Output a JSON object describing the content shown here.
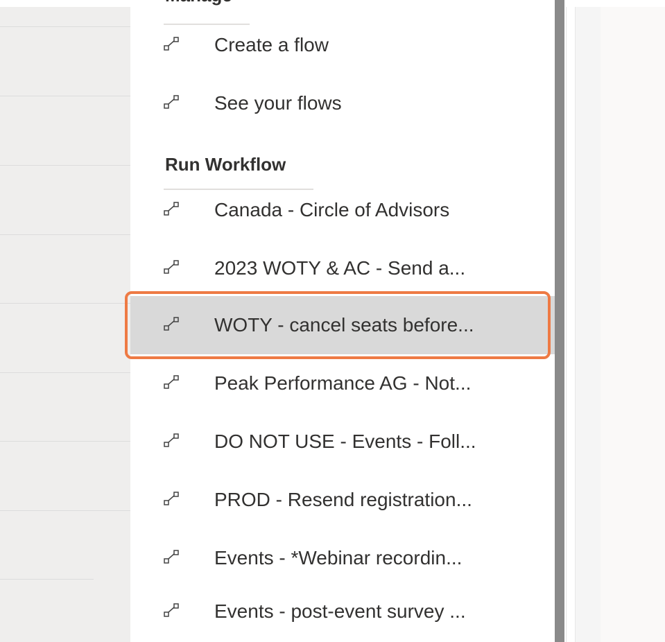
{
  "menu": {
    "sections": [
      {
        "title": "Manage",
        "items": [
          {
            "label": "Create a flow",
            "icon": "flow-icon"
          },
          {
            "label": "See your flows",
            "icon": "flow-icon"
          }
        ]
      },
      {
        "title": "Run Workflow",
        "items": [
          {
            "label": "Canada - Circle of Advisors",
            "icon": "flow-icon"
          },
          {
            "label": "2023 WOTY & AC - Send a...",
            "icon": "flow-icon"
          },
          {
            "label": "WOTY - cancel seats before...",
            "icon": "flow-icon",
            "selected": true
          },
          {
            "label": "Peak Performance AG - Not...",
            "icon": "flow-icon"
          },
          {
            "label": "DO NOT USE - Events - Foll...",
            "icon": "flow-icon"
          },
          {
            "label": "PROD - Resend registration...",
            "icon": "flow-icon"
          },
          {
            "label": "Events - *Webinar recordin...",
            "icon": "flow-icon"
          },
          {
            "label": "Events - post-event survey ...",
            "icon": "flow-icon"
          }
        ]
      }
    ]
  },
  "colors": {
    "highlight_border": "#ee7a44",
    "selected_bg": "#d9d9d9",
    "scrollbar_thumb": "#8a8a8a"
  }
}
